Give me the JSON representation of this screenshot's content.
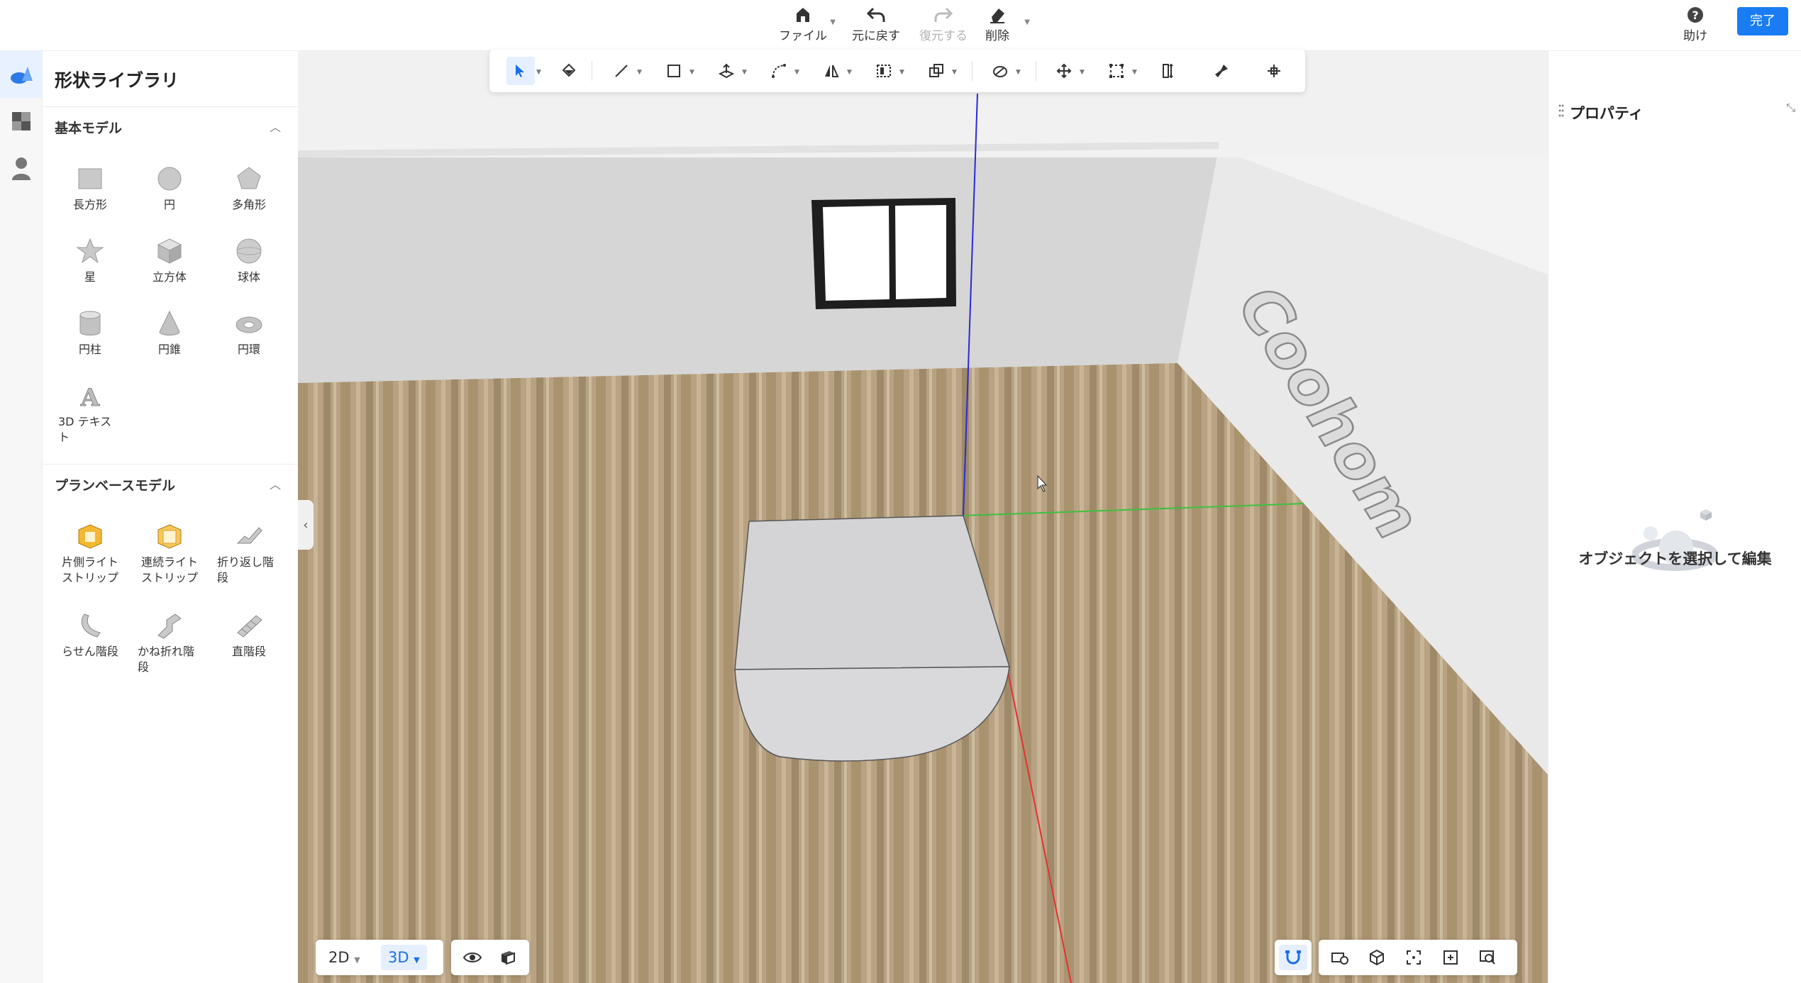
{
  "topbar": {
    "file_label": "ファイル",
    "undo_label": "元に戻す",
    "redo_label": "復元する",
    "delete_label": "削除",
    "help_label": "助け",
    "done_label": "完了"
  },
  "rail": {
    "items": [
      {
        "icon": "shapes-icon",
        "active": true
      },
      {
        "icon": "material-icon",
        "active": false
      },
      {
        "icon": "user-icon",
        "active": false
      }
    ]
  },
  "library": {
    "title": "形状ライブラリ",
    "basic": {
      "heading": "基本モデル",
      "items": [
        "長方形",
        "円",
        "多角形",
        "星",
        "立方体",
        "球体",
        "円柱",
        "円錐",
        "円環",
        "3D テキスト"
      ]
    },
    "plan": {
      "heading": "プランベースモデル",
      "items": [
        "片側ライトストリップ",
        "連続ライトストリップ",
        "折り返し階段",
        "らせん階段",
        "かね折れ階段",
        "直階段"
      ]
    }
  },
  "viewport": {
    "wall_text": "Coohom"
  },
  "view_switch": {
    "option_2d": "2D",
    "option_3d": "3D",
    "active": "3D"
  },
  "properties": {
    "title": "プロパティ",
    "empty_message": "オブジェクトを選択して編集"
  },
  "colors": {
    "accent": "#1a7cf2",
    "floor": "#b09a7a",
    "wall": "#d8d8d8",
    "axis_x": "#e53030",
    "axis_y": "#3fbf3f",
    "axis_z": "#2a2ad8"
  }
}
